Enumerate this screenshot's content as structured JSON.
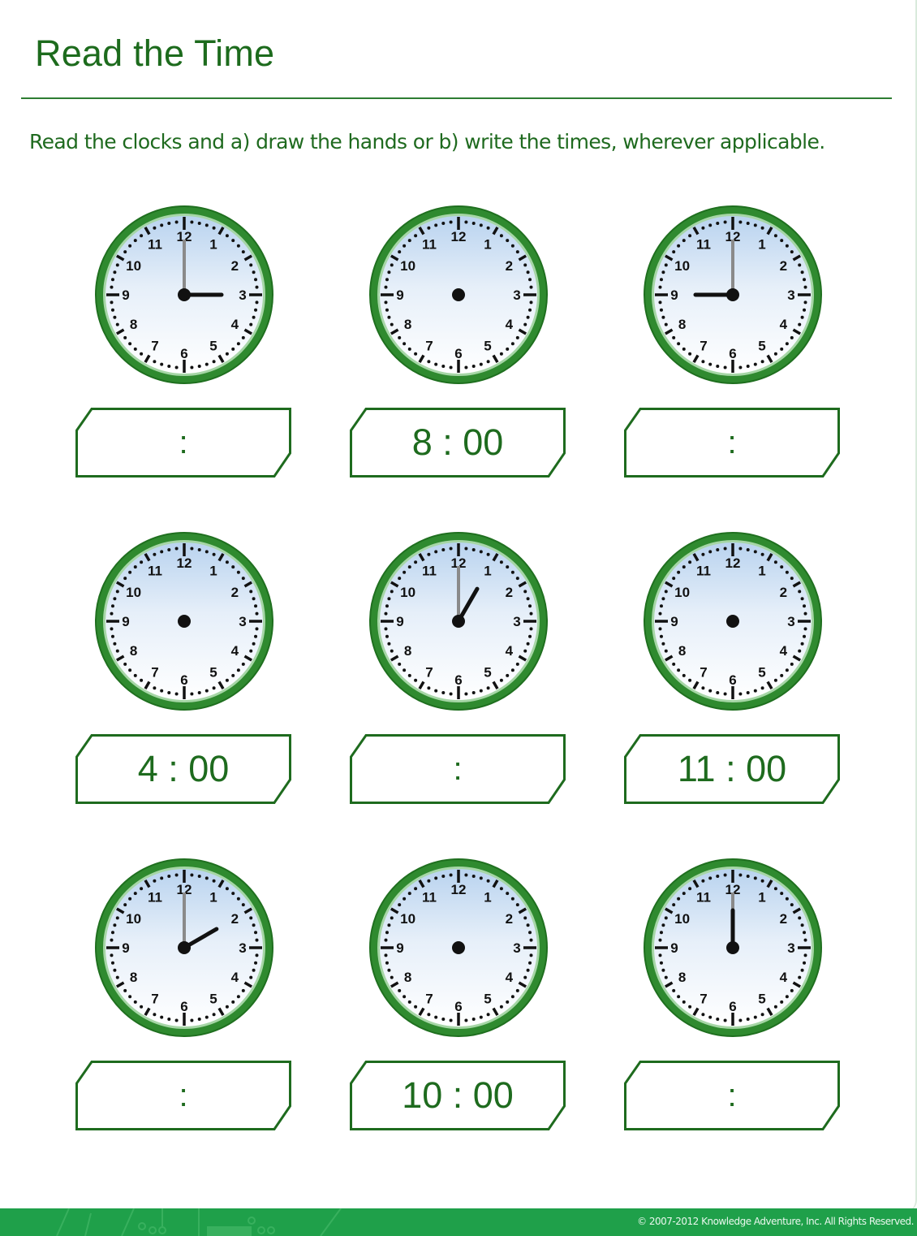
{
  "worksheet": {
    "title": "Read the Time",
    "instructions": "Read the clocks and a) draw the hands or b) write the times, wherever applicable.",
    "colors": {
      "accent": "#1e6b1e",
      "ring": "#2e8b2e",
      "footer": "#1fa04a"
    },
    "clocks": [
      {
        "label": "clock-1",
        "hands_shown": true,
        "hour": 3,
        "minute": 0,
        "answer": "",
        "answer_placeholder": ":"
      },
      {
        "label": "clock-2",
        "hands_shown": false,
        "hour": null,
        "minute": null,
        "answer": "8 : 00",
        "answer_placeholder": ":"
      },
      {
        "label": "clock-3",
        "hands_shown": true,
        "hour": 9,
        "minute": 0,
        "answer": "",
        "answer_placeholder": ":"
      },
      {
        "label": "clock-4",
        "hands_shown": false,
        "hour": null,
        "minute": null,
        "answer": "4 : 00",
        "answer_placeholder": ":"
      },
      {
        "label": "clock-5",
        "hands_shown": true,
        "hour": 1,
        "minute": 0,
        "answer": "",
        "answer_placeholder": ":"
      },
      {
        "label": "clock-6",
        "hands_shown": false,
        "hour": null,
        "minute": null,
        "answer": "11 : 00",
        "answer_placeholder": ":"
      },
      {
        "label": "clock-7",
        "hands_shown": true,
        "hour": 2,
        "minute": 0,
        "answer": "",
        "answer_placeholder": ":"
      },
      {
        "label": "clock-8",
        "hands_shown": false,
        "hour": null,
        "minute": null,
        "answer": "10 : 00",
        "answer_placeholder": ":"
      },
      {
        "label": "clock-9",
        "hands_shown": true,
        "hour": 12,
        "minute": 0,
        "answer": "",
        "answer_placeholder": ":"
      }
    ],
    "dial_numbers": [
      "12",
      "1",
      "2",
      "3",
      "4",
      "5",
      "6",
      "7",
      "8",
      "9",
      "10",
      "11"
    ]
  },
  "footer": {
    "copyright": "© 2007-2012 Knowledge Adventure, Inc. All Rights Reserved."
  }
}
